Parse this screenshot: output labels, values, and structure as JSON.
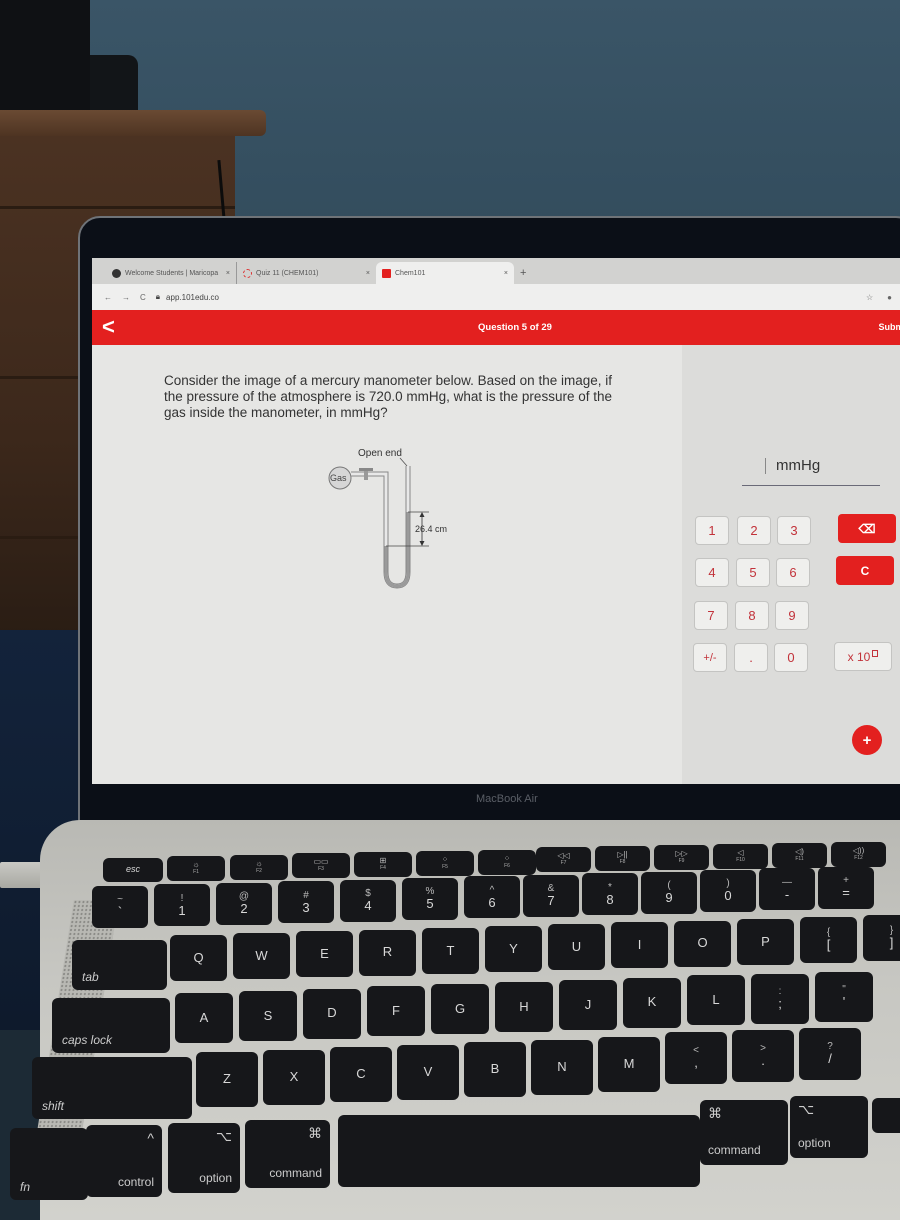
{
  "browser": {
    "tabs": [
      {
        "label": "Welcome Students | Maricopa",
        "icon": "maricopa-icon",
        "active": false
      },
      {
        "label": "Quiz 11 (CHEM101)",
        "icon": "quiz-icon",
        "active": false
      },
      {
        "label": "Chem101",
        "icon": "chem101-icon",
        "active": true
      }
    ],
    "close_glyph": "×",
    "new_tab_glyph": "+",
    "url": "app.101edu.co",
    "nav": {
      "back": "←",
      "forward": "→",
      "reload": "C"
    },
    "bookmark_glyph": "☆",
    "profile_glyph": "●"
  },
  "app": {
    "back_glyph": "<",
    "question_counter": "Question 5 of 29",
    "submit_label": "Submi",
    "accent_color": "#e3201f",
    "question_text": "Consider the image of a mercury manometer below. Based on the image, if the pressure of the atmosphere is 720.0 mmHg, what is the pressure of the gas inside the manometer, in mmHg?",
    "diagram": {
      "open_end_label": "Open end",
      "gas_label": "Gas",
      "height_label": "26.4 cm"
    },
    "answer": {
      "value": "",
      "unit": "mmHg"
    },
    "keypad": {
      "digits": [
        "1",
        "2",
        "3",
        "4",
        "5",
        "6",
        "7",
        "8",
        "9"
      ],
      "plus_minus": "+/-",
      "decimal": ".",
      "zero": "0",
      "backspace_glyph": "⌫",
      "clear": "C",
      "x10": "x 10",
      "fab": "+"
    }
  },
  "device": {
    "brand": "MacBook Air"
  },
  "keyboard": {
    "esc": "esc",
    "fkeys": [
      {
        "icon": "☼",
        "label": "F1"
      },
      {
        "icon": "☼",
        "label": "F2"
      },
      {
        "icon": "▭▭",
        "label": "F3"
      },
      {
        "icon": "⊞",
        "label": "F4"
      },
      {
        "icon": "⁘",
        "label": "F5"
      },
      {
        "icon": "⁘",
        "label": "F6"
      },
      {
        "icon": "◁◁",
        "label": "F7"
      },
      {
        "icon": "▷||",
        "label": "F8"
      },
      {
        "icon": "▷▷",
        "label": "F9"
      },
      {
        "icon": "◁",
        "label": "F10"
      },
      {
        "icon": "◁)",
        "label": "F11"
      },
      {
        "icon": "◁))",
        "label": "F12"
      }
    ],
    "number_row": [
      {
        "top": "~",
        "main": "`"
      },
      {
        "top": "!",
        "main": "1"
      },
      {
        "top": "@",
        "main": "2"
      },
      {
        "top": "#",
        "main": "3"
      },
      {
        "top": "$",
        "main": "4"
      },
      {
        "top": "%",
        "main": "5"
      },
      {
        "top": "^",
        "main": "6"
      },
      {
        "top": "&",
        "main": "7"
      },
      {
        "top": "*",
        "main": "8"
      },
      {
        "top": "(",
        "main": "9"
      },
      {
        "top": ")",
        "main": "0"
      },
      {
        "top": "—",
        "main": "-"
      },
      {
        "top": "+",
        "main": "="
      }
    ],
    "row_q": [
      "Q",
      "W",
      "E",
      "R",
      "T",
      "Y",
      "U",
      "I",
      "O",
      "P"
    ],
    "row_q_extra": [
      {
        "top": "{",
        "main": "["
      },
      {
        "top": "}",
        "main": "]"
      }
    ],
    "row_a": [
      "A",
      "S",
      "D",
      "F",
      "G",
      "H",
      "J",
      "K",
      "L"
    ],
    "row_a_extra": [
      {
        "top": ":",
        "main": ";"
      },
      {
        "top": "\"",
        "main": "'"
      }
    ],
    "row_z": [
      "Z",
      "X",
      "C",
      "V",
      "B",
      "N",
      "M"
    ],
    "row_z_extra": [
      {
        "top": "<",
        "main": ","
      },
      {
        "top": ">",
        "main": "."
      },
      {
        "top": "?",
        "main": "/"
      }
    ],
    "tab": "tab",
    "caps": "caps lock",
    "shift": "shift",
    "fn": "fn",
    "control": {
      "sym": "^",
      "label": "control"
    },
    "option_left": {
      "sym": "⌥",
      "label": "option"
    },
    "command_left": {
      "sym": "⌘",
      "label": "command"
    },
    "command_right": {
      "sym": "⌘",
      "label": "command"
    },
    "option_right": {
      "sym": "⌥",
      "label": "option"
    }
  }
}
